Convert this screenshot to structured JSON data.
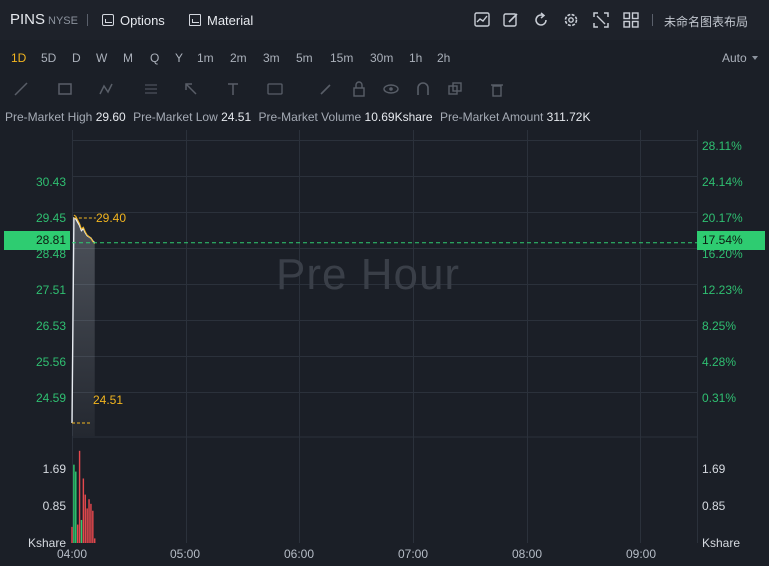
{
  "header": {
    "symbol": "PINS",
    "exchange": "NYSE",
    "options_label": "Options",
    "material_label": "Material",
    "layout_name": "未命名图表布局"
  },
  "periods": {
    "items": [
      "1D",
      "5D",
      "D",
      "W",
      "M",
      "Q",
      "Y",
      "1m",
      "2m",
      "3m",
      "5m",
      "15m",
      "30m",
      "1h",
      "2h"
    ],
    "active": "1D",
    "scale_mode": "Auto"
  },
  "info": {
    "high_label": "Pre-Market High",
    "high_value": "29.60",
    "low_label": "Pre-Market Low",
    "low_value": "24.51",
    "volume_label": "Pre-Market Volume",
    "volume_value": "10.69Kshare",
    "amount_label": "Pre-Market Amount",
    "amount_value": "311.72K"
  },
  "chart": {
    "watermark": "Pre Hour",
    "current_price": "28.81",
    "current_pct": "17.54%",
    "high_marker": "29.40",
    "low_marker": "24.51",
    "price_ticks": [
      "30.43",
      "29.45",
      "28.48",
      "27.51",
      "26.53",
      "25.56",
      "24.59"
    ],
    "pct_ticks": [
      "28.11%",
      "24.14%",
      "20.17%",
      "16.20%",
      "12.23%",
      "8.25%",
      "4.28%",
      "0.31%"
    ],
    "volume_ticks": [
      "1.69",
      "0.85"
    ],
    "volume_unit": "Kshare",
    "time_ticks": [
      "04:00",
      "05:00",
      "06:00",
      "07:00",
      "08:00",
      "09:00"
    ],
    "colors": {
      "up": "#2ecc71",
      "down": "#e5484d",
      "accent": "#f2b51f",
      "grid": "#2b313b",
      "background": "#1b1f27"
    }
  },
  "chart_data": {
    "type": "line",
    "title": "",
    "xlabel": "",
    "ylabel": "",
    "x": [
      "04:00",
      "04:01",
      "04:02",
      "04:03",
      "04:04",
      "04:05",
      "04:06",
      "04:07",
      "04:08",
      "04:09",
      "04:10",
      "04:11",
      "04:12"
    ],
    "values": [
      24.51,
      29.4,
      29.38,
      29.3,
      29.22,
      29.1,
      29.15,
      29.05,
      28.98,
      28.95,
      28.92,
      28.85,
      28.81
    ],
    "ylim": [
      24.2,
      31.5
    ],
    "xlim": [
      "04:00",
      "09:30"
    ],
    "session_high": 29.6,
    "session_low": 24.51,
    "last_price": 28.81,
    "volume_unit": "Kshare",
    "volume": [
      {
        "time": "04:00",
        "value": 0.35,
        "dir": "down"
      },
      {
        "time": "04:01",
        "value": 1.7,
        "dir": "up"
      },
      {
        "time": "04:02",
        "value": 1.55,
        "dir": "up"
      },
      {
        "time": "04:03",
        "value": 0.4,
        "dir": "down"
      },
      {
        "time": "04:04",
        "value": 2.0,
        "dir": "down"
      },
      {
        "time": "04:05",
        "value": 0.5,
        "dir": "up"
      },
      {
        "time": "04:06",
        "value": 1.4,
        "dir": "down"
      },
      {
        "time": "04:07",
        "value": 1.05,
        "dir": "down"
      },
      {
        "time": "04:08",
        "value": 0.75,
        "dir": "down"
      },
      {
        "time": "04:09",
        "value": 0.95,
        "dir": "down"
      },
      {
        "time": "04:10",
        "value": 0.85,
        "dir": "down"
      },
      {
        "time": "04:11",
        "value": 0.7,
        "dir": "down"
      },
      {
        "time": "04:12",
        "value": 0.1,
        "dir": "down"
      }
    ],
    "volume_ylim": [
      0,
      2.3
    ],
    "grid": true
  },
  "icons": {
    "right": [
      "indicator-chart-icon",
      "edit-icon",
      "refresh-icon",
      "settings-icon",
      "fullscreen-icon",
      "layout-grid-icon"
    ],
    "tools": [
      "line-tool-icon",
      "rectangle-tool-icon",
      "pattern-tool-icon",
      "fibonacci-tool-icon",
      "arrow-tool-icon",
      "text-tool-icon",
      "annotation-tool-icon",
      "pen-tool-icon",
      "lock-tool-icon",
      "eye-tool-icon",
      "magnet-tool-icon",
      "clone-tool-icon",
      "trash-tool-icon"
    ]
  }
}
